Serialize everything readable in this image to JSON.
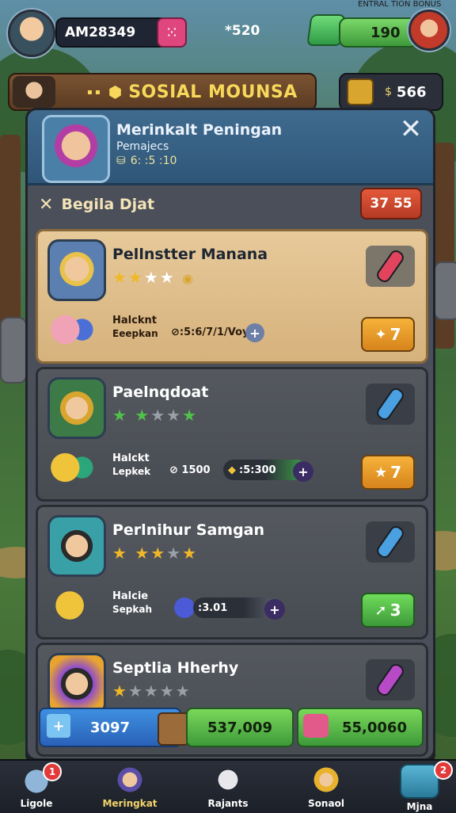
{
  "hud": {
    "player_name": "AM28349",
    "energy": "*520",
    "gems": "190",
    "watermark": "ENTRAL TION BONUS"
  },
  "banner": {
    "title": "SOSIAL MOUNSA",
    "coins": "566"
  },
  "panel": {
    "title": "Merinkalt Peningan",
    "subtitle": "Pemajecs",
    "stat": "6: :5 :10",
    "section_title": "Begila Djat",
    "timer": "37 55",
    "close_glyph": "✕"
  },
  "cards": [
    {
      "name": "Pellnstter Manana",
      "stars_filled": 2,
      "stars_total": 4,
      "detail_label": "Halcknt",
      "detail_sub": "Eeepkan",
      "progress_text": "⊘:5:6/7/1/Voy",
      "action_value": "7",
      "active": true,
      "tool_color": "#e2445e"
    },
    {
      "name": "Paelnqdoat",
      "stars_filled": 2,
      "stars_total": 5,
      "detail_label": "Halckt",
      "detail_sub": "Lepkek",
      "progress_text": "⊘ 1500",
      "progress_text2": ":5:300",
      "action_value": "7",
      "active": false,
      "tool_color": "#4aa0e0"
    },
    {
      "name": "Perlnihur Samgan",
      "stars_filled": 3,
      "stars_total": 4,
      "detail_label": "Halcie",
      "detail_sub": "Sepkah",
      "progress_text": ":3.01",
      "action_value": "3",
      "active": false,
      "tool_color": "#4aa0e0"
    },
    {
      "name": "Septlia Hherhy",
      "stars_filled": 1,
      "stars_total": 5,
      "active": false,
      "tool_color": "#b84ac8"
    }
  ],
  "currency": {
    "blue": "3097",
    "green1": "537,009",
    "green2": "55,0060"
  },
  "nav": [
    {
      "label": "Ligole",
      "badge": "1"
    },
    {
      "label": "Meringkat",
      "badge": ""
    },
    {
      "label": "Rajants",
      "badge": ""
    },
    {
      "label": "Sonaol",
      "badge": ""
    },
    {
      "label": "Mjna",
      "badge": "2"
    }
  ]
}
